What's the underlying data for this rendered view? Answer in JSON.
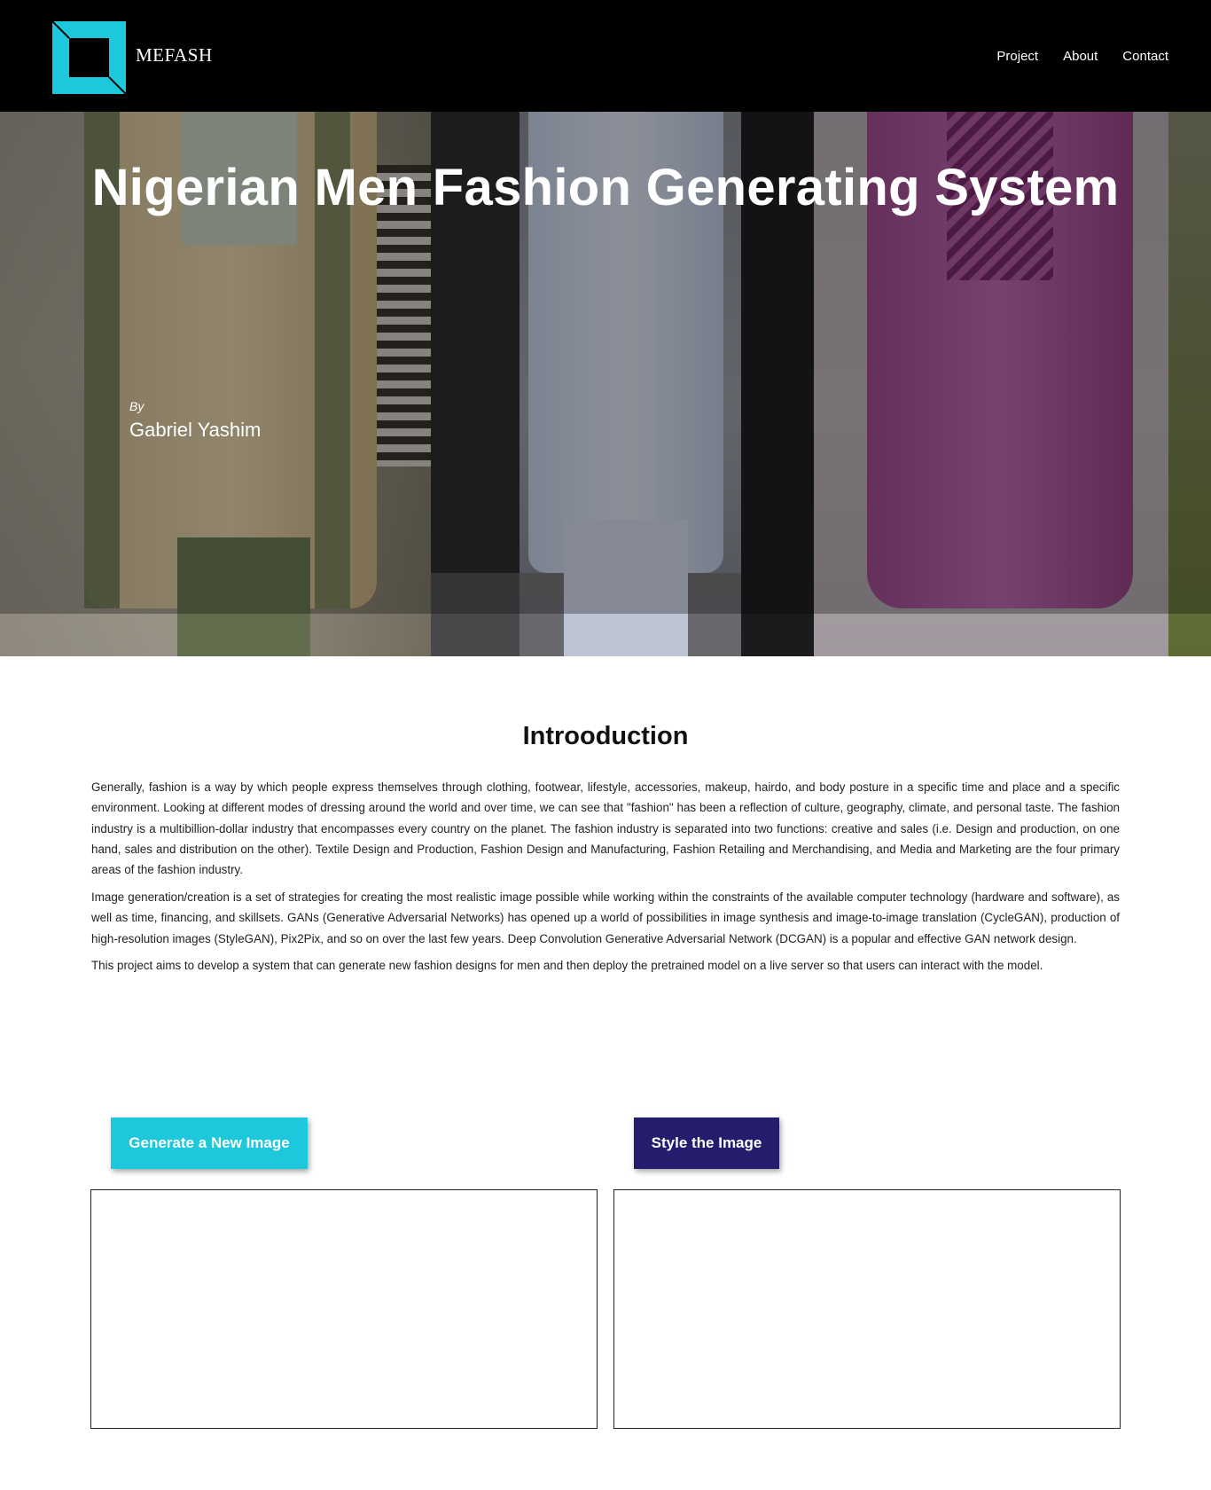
{
  "header": {
    "logo_text": "MEFASH",
    "logo_icon": "square-frame-logo",
    "nav": [
      {
        "label": "Project"
      },
      {
        "label": "About"
      },
      {
        "label": "Contact"
      }
    ]
  },
  "hero": {
    "title": "Nigerian Men Fashion Generating System",
    "by_label": "By",
    "author": "Gabriel Yashim"
  },
  "intro": {
    "title": "Introoduction",
    "paragraphs": [
      "Generally, fashion is a way by which people express themselves through clothing, footwear, lifestyle, accessories, makeup, hairdo, and body posture in a specific time and place and a specific environment. Looking at different modes of dressing around the world and over time, we can see that \"fashion\" has been a reflection of culture, geography, climate, and personal taste. The fashion industry is a multibillion-dollar industry that encompasses every country on the planet. The fashion industry is separated into two functions: creative and sales (i.e. Design and production, on one hand, sales and distribution on the other). Textile Design and Production, Fashion Design and Manufacturing, Fashion Retailing and Merchandising, and Media and Marketing are the four primary areas of the fashion industry.",
      "Image generation/creation is a set of strategies for creating the most realistic image possible while working within the constraints of the available computer technology (hardware and software), as well as time, financing, and skillsets. GANs (Generative Adversarial Networks) has opened up a world of possibilities in image synthesis and image-to-image translation (CycleGAN), production of high-resolution images (StyleGAN), Pix2Pix, and so on over the last few years. Deep Convolution Generative Adversarial Network (DCGAN) is a popular and effective GAN network design.",
      "This project aims to develop a system that can generate new fashion designs for men and then deploy the pretrained model on a live server so that users can interact with the model."
    ]
  },
  "actions": {
    "generate_label": "Generate a New Image",
    "style_label": "Style the Image"
  },
  "colors": {
    "header_bg": "#000000",
    "accent_cyan": "#1ec8dc",
    "accent_indigo": "#241c6c"
  }
}
